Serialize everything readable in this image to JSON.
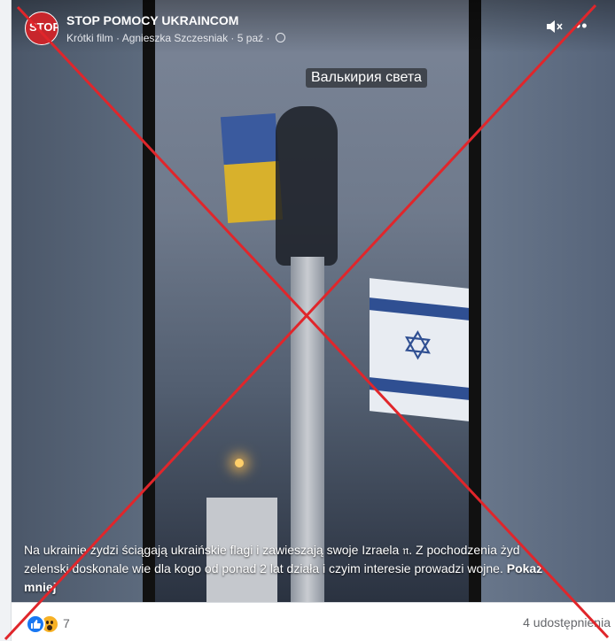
{
  "post": {
    "page_name": "STOP POMOCY UKRAINCOM",
    "avatar_text": "STOP",
    "meta_type": "Krótki film",
    "meta_author": "Agnieszka Szczesniak",
    "meta_date": "5 paź",
    "separator": "·"
  },
  "video": {
    "watermark": "Валькирия света",
    "mute_icon": "speaker-muted-icon",
    "more_icon": "more-dots-icon"
  },
  "caption": {
    "text": "Na ukrainie żydzi ściągają ukraińskie flagi i zawieszają swoje Izraela 𝔫. Z pochodzenia żyd zelenski doskonale wie dla kogo od ponad 2 lat działa i czyim interesie prowadzi wojne.",
    "show_less": "Pokaż mniej"
  },
  "footer": {
    "reaction_count": "7",
    "shares": "4 udostępnienia"
  },
  "overlay": {
    "cross_color": "#e0262b"
  }
}
